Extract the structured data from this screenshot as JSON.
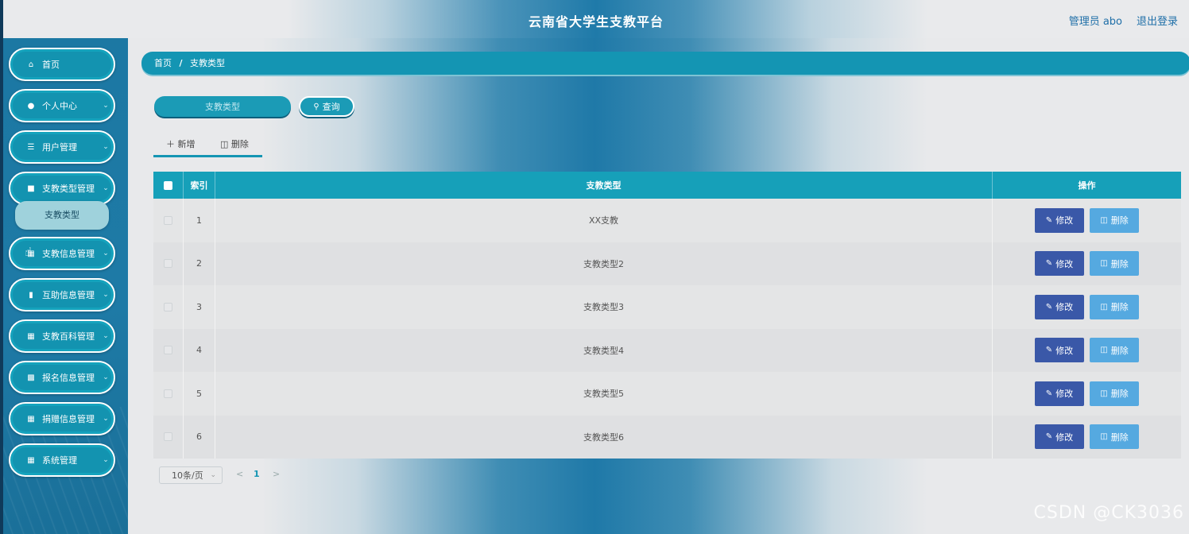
{
  "header": {
    "title": "云南省大学生支教平台",
    "user": "管理员 abo",
    "logout": "退出登录"
  },
  "sidebar": {
    "items": [
      {
        "label": "首页",
        "icon": "home-icon"
      },
      {
        "label": "个人中心",
        "icon": "user-icon"
      },
      {
        "label": "用户管理",
        "icon": "list-icon"
      },
      {
        "label": "支教类型管理",
        "icon": "chart-icon"
      },
      {
        "label": "支教信息管理",
        "icon": "grid-icon"
      },
      {
        "label": "互助信息管理",
        "icon": "clipboard-icon"
      },
      {
        "label": "支教百科管理",
        "icon": "grid-icon"
      },
      {
        "label": "报名信息管理",
        "icon": "bar-chart-icon"
      },
      {
        "label": "捐赠信息管理",
        "icon": "grid-icon"
      },
      {
        "label": "系统管理",
        "icon": "grid-icon"
      }
    ],
    "submenu": {
      "label": "支教类型"
    }
  },
  "breadcrumb": {
    "home": "首页",
    "separator": "/",
    "current": "支教类型"
  },
  "search": {
    "placeholder": "支教类型",
    "button": "查询"
  },
  "actions": {
    "add": "新增",
    "delete": "删除"
  },
  "table": {
    "headers": {
      "index": "索引",
      "type": "支教类型",
      "ops": "操作"
    },
    "rows": [
      {
        "index": "1",
        "type": "XX支教"
      },
      {
        "index": "2",
        "type": "支教类型2"
      },
      {
        "index": "3",
        "type": "支教类型3"
      },
      {
        "index": "4",
        "type": "支教类型4"
      },
      {
        "index": "5",
        "type": "支教类型5"
      },
      {
        "index": "6",
        "type": "支教类型6"
      }
    ],
    "edit_label": "修改",
    "delete_label": "删除"
  },
  "pagination": {
    "page_size": "10条/页",
    "current_page": "1"
  },
  "watermark": "CSDN @CK3036",
  "colors": {
    "primary": "#1495b3",
    "edit_button": "#3a58a8",
    "delete_button": "#55a9e0",
    "header_text": "#1f6fa8"
  }
}
